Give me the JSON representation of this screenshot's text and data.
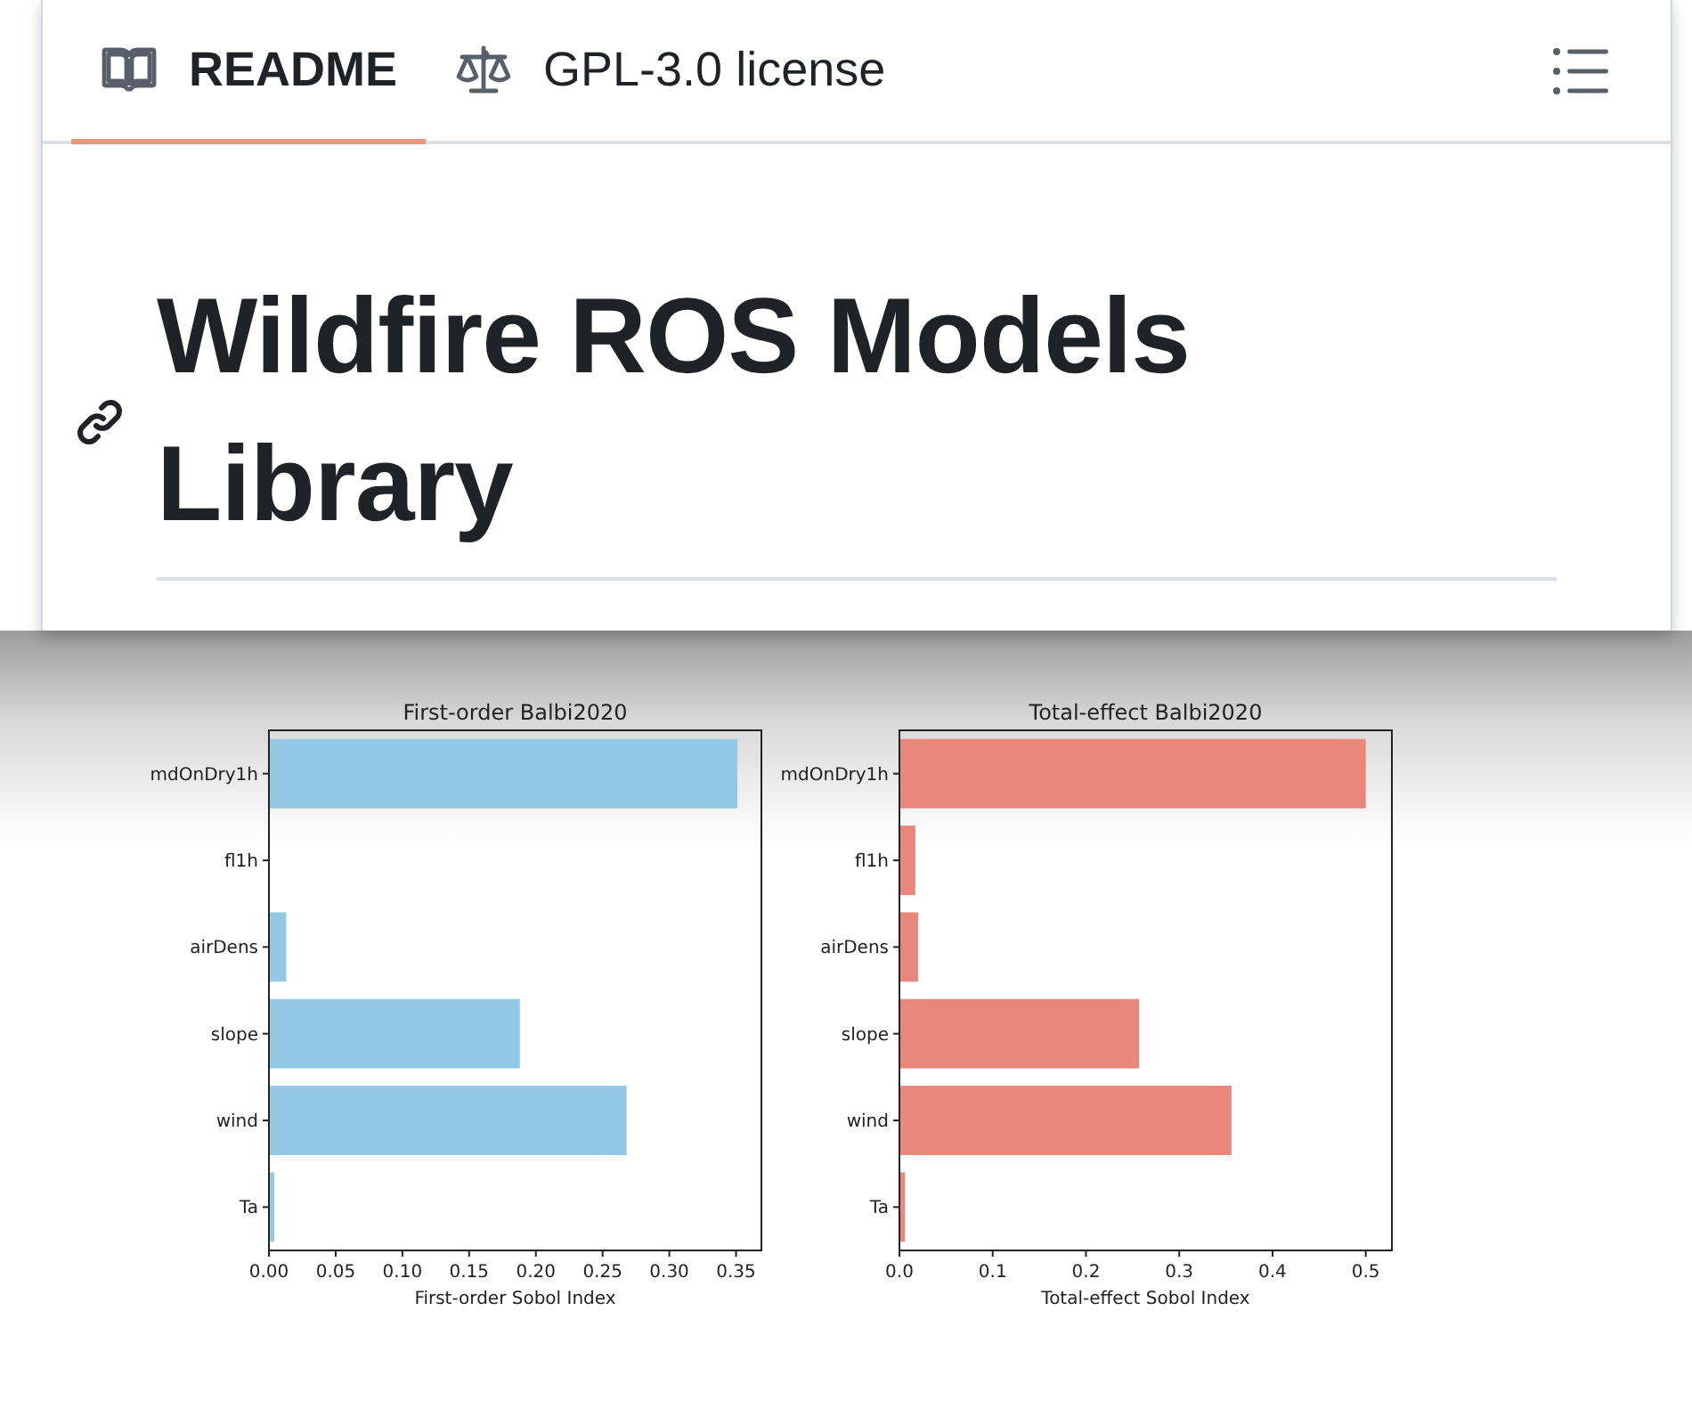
{
  "tabs": [
    {
      "label": "README",
      "kind": "book",
      "selected": true
    },
    {
      "label": "GPL-3.0 license",
      "kind": "scale",
      "selected": false
    }
  ],
  "heading": "Wildfire ROS Models Library",
  "charts": [
    {
      "chart_data": {
        "type": "bar",
        "orientation": "horizontal",
        "title": "First-order Balbi2020",
        "xlabel": "First-order Sobol Index",
        "categories": [
          "mdOnDry1h",
          "fl1h",
          "airDens",
          "slope",
          "wind",
          "Ta"
        ],
        "series": [
          {
            "color": "#93c9e6",
            "values": [
              0.351,
              0,
              0.013,
              0.188,
              0.268,
              0.004
            ]
          }
        ],
        "xlim": [
          0,
          0.369
        ],
        "xticks": [
          {
            "value": 0,
            "label": "0.00"
          },
          {
            "value": 0.05,
            "label": "0.05"
          },
          {
            "value": 0.1,
            "label": "0.10"
          },
          {
            "value": 0.15,
            "label": "0.15"
          },
          {
            "value": 0.2,
            "label": "0.20"
          },
          {
            "value": 0.25,
            "label": "0.25"
          },
          {
            "value": 0.3,
            "label": "0.30"
          },
          {
            "value": 0.35,
            "label": "0.35"
          }
        ]
      }
    },
    {
      "chart_data": {
        "type": "bar",
        "orientation": "horizontal",
        "title": "Total-effect Balbi2020",
        "xlabel": "Total-effect Sobol Index",
        "categories": [
          "mdOnDry1h",
          "fl1h",
          "airDens",
          "slope",
          "wind",
          "Ta"
        ],
        "series": [
          {
            "color": "#e8877a",
            "values": [
              0.5,
              0.017,
              0.02,
              0.257,
              0.356,
              0.006
            ]
          }
        ],
        "xlim": [
          0,
          0.528
        ],
        "xticks": [
          {
            "value": 0,
            "label": "0.0"
          },
          {
            "value": 0.1,
            "label": "0.1"
          },
          {
            "value": 0.2,
            "label": "0.2"
          },
          {
            "value": 0.3,
            "label": "0.3"
          },
          {
            "value": 0.4,
            "label": "0.4"
          },
          {
            "value": 0.5,
            "label": "0.5"
          }
        ]
      }
    }
  ]
}
